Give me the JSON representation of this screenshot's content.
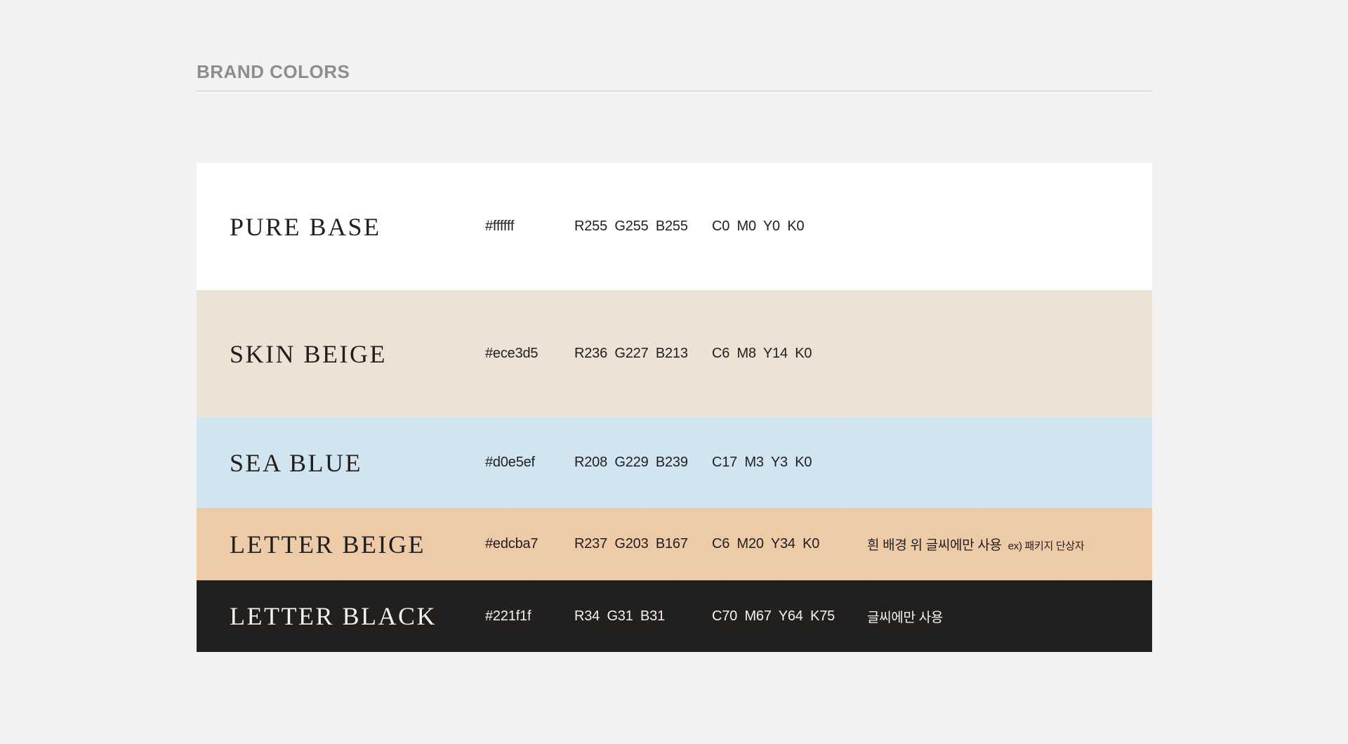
{
  "theme": {
    "page_bg": "#f1f2f1",
    "title_color": "#8b8e8c",
    "rule_color": "#c9cccb"
  },
  "header": {
    "title": "BRAND COLORS"
  },
  "palette": {
    "rows": [
      {
        "name": "PURE BASE",
        "hex": "#ffffff",
        "rgb": "R255 G255 B255",
        "cmyk": "C0 M0 Y0 K0",
        "note": "",
        "note_detail": "",
        "swatch": "#ffffff",
        "text_color": "#211e1e"
      },
      {
        "name": "SKIN BEIGE",
        "hex": "#ece3d5",
        "rgb": "R236 G227 B213",
        "cmyk": "C6 M8 Y14 K0",
        "note": "",
        "note_detail": "",
        "swatch": "#ece3d5",
        "text_color": "#211e1e"
      },
      {
        "name": "SEA BLUE",
        "hex": "#d0e5ef",
        "rgb": "R208 G229 B239",
        "cmyk": "C17 M3 Y3 K0",
        "note": "",
        "note_detail": "",
        "swatch": "#d0e5ef",
        "text_color": "#211e1e"
      },
      {
        "name": "LETTER BEIGE",
        "hex": "#edcba7",
        "rgb": "R237 G203 B167",
        "cmyk": "C6 M20 Y34 K0",
        "note": "흰 배경 위  글씨에만 사용",
        "note_detail": "ex) 패키지 단상자",
        "swatch": "#edcba7",
        "text_color": "#211e1e"
      },
      {
        "name": "LETTER BLACK",
        "hex": "#221f1f",
        "rgb": "R34 G31 B31",
        "cmyk": "C70 M67 Y64 K75",
        "note": "글씨에만 사용",
        "note_detail": "",
        "swatch": "#221f1f",
        "text_color": "#f6f3ef"
      }
    ]
  }
}
